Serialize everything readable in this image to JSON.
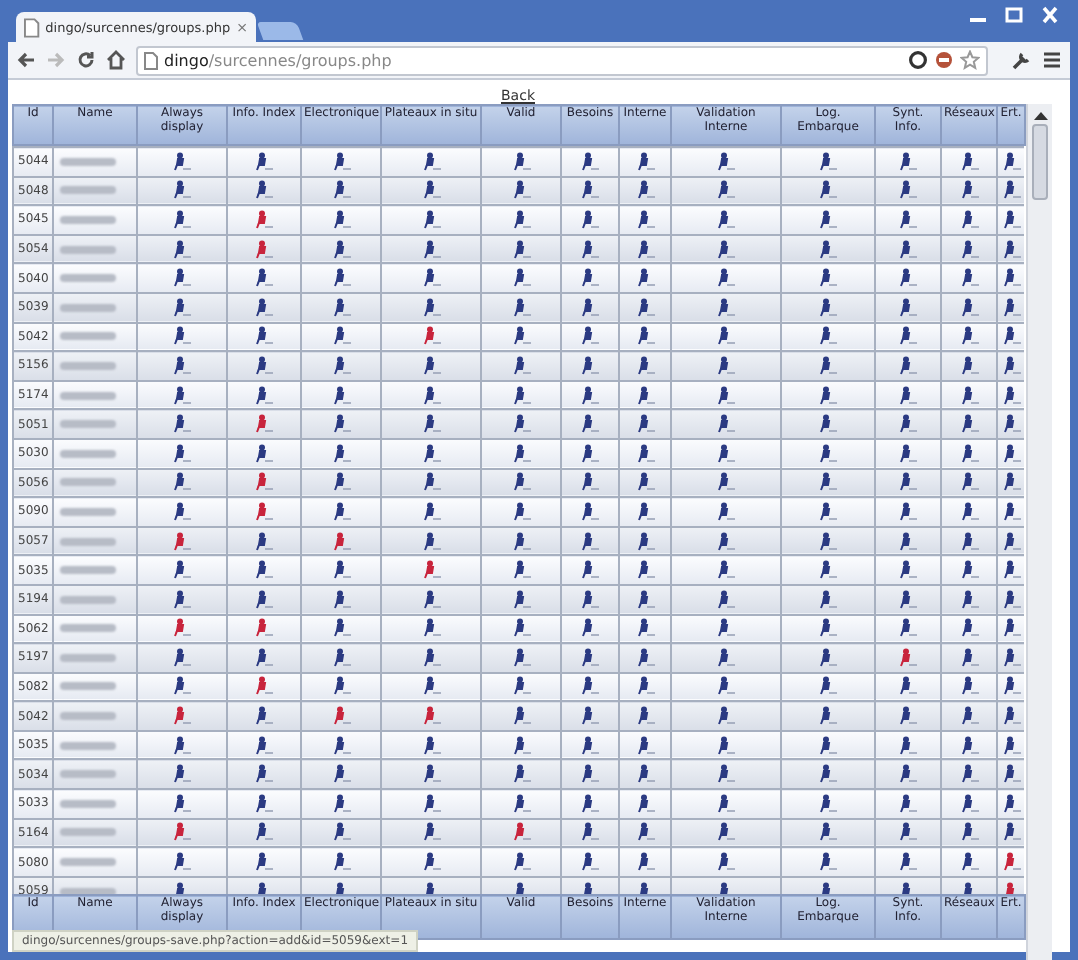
{
  "window": {
    "tab_title": "dingo/surcennes/groups.php",
    "tab_close": "×"
  },
  "address_bar": {
    "host": "dingo",
    "path": "/surcennes/groups.php"
  },
  "back_link": "Back",
  "columns": [
    "Id",
    "Name",
    "Always display",
    "Info. Index",
    "Electronique",
    "Plateaux in situ",
    "Valid",
    "Besoins",
    "Interne",
    "Validation Interne",
    "Log. Embarque",
    "Synt. Info.",
    "Réseaux",
    "Ert."
  ],
  "rows": [
    {
      "id": "5044",
      "alerts": [
        false,
        false,
        false,
        false,
        false,
        false,
        false,
        false,
        false,
        false,
        false,
        false
      ]
    },
    {
      "id": "5048",
      "alerts": [
        false,
        false,
        false,
        false,
        false,
        false,
        false,
        false,
        false,
        false,
        false,
        false
      ]
    },
    {
      "id": "5045",
      "alerts": [
        false,
        true,
        false,
        false,
        false,
        false,
        false,
        false,
        false,
        false,
        false,
        false
      ]
    },
    {
      "id": "5054",
      "alerts": [
        false,
        true,
        false,
        false,
        false,
        false,
        false,
        false,
        false,
        false,
        false,
        false
      ]
    },
    {
      "id": "5040",
      "alerts": [
        false,
        false,
        false,
        false,
        false,
        false,
        false,
        false,
        false,
        false,
        false,
        false
      ]
    },
    {
      "id": "5039",
      "alerts": [
        false,
        false,
        false,
        false,
        false,
        false,
        false,
        false,
        false,
        false,
        false,
        false
      ]
    },
    {
      "id": "5042",
      "alerts": [
        false,
        false,
        false,
        true,
        false,
        false,
        false,
        false,
        false,
        false,
        false,
        false
      ]
    },
    {
      "id": "5156",
      "alerts": [
        false,
        false,
        false,
        false,
        false,
        false,
        false,
        false,
        false,
        false,
        false,
        false
      ]
    },
    {
      "id": "5174",
      "alerts": [
        false,
        false,
        false,
        false,
        false,
        false,
        false,
        false,
        false,
        false,
        false,
        false
      ]
    },
    {
      "id": "5051",
      "alerts": [
        false,
        true,
        false,
        false,
        false,
        false,
        false,
        false,
        false,
        false,
        false,
        false
      ]
    },
    {
      "id": "5030",
      "alerts": [
        false,
        false,
        false,
        false,
        false,
        false,
        false,
        false,
        false,
        false,
        false,
        false
      ]
    },
    {
      "id": "5056",
      "alerts": [
        false,
        true,
        false,
        false,
        false,
        false,
        false,
        false,
        false,
        false,
        false,
        false
      ]
    },
    {
      "id": "5090",
      "alerts": [
        false,
        true,
        false,
        false,
        false,
        false,
        false,
        false,
        false,
        false,
        false,
        false
      ]
    },
    {
      "id": "5057",
      "alerts": [
        true,
        false,
        true,
        false,
        false,
        false,
        false,
        false,
        false,
        false,
        false,
        false
      ]
    },
    {
      "id": "5035",
      "alerts": [
        false,
        false,
        false,
        true,
        false,
        false,
        false,
        false,
        false,
        false,
        false,
        false
      ]
    },
    {
      "id": "5194",
      "alerts": [
        false,
        false,
        false,
        false,
        false,
        false,
        false,
        false,
        false,
        false,
        false,
        false
      ]
    },
    {
      "id": "5062",
      "alerts": [
        true,
        true,
        false,
        false,
        false,
        false,
        false,
        false,
        false,
        false,
        false,
        false
      ]
    },
    {
      "id": "5197",
      "alerts": [
        false,
        false,
        false,
        false,
        false,
        false,
        false,
        false,
        false,
        true,
        false,
        false
      ]
    },
    {
      "id": "5082",
      "alerts": [
        false,
        true,
        false,
        false,
        false,
        false,
        false,
        false,
        false,
        false,
        false,
        false
      ]
    },
    {
      "id": "5042",
      "alerts": [
        true,
        false,
        true,
        true,
        false,
        false,
        false,
        false,
        false,
        false,
        false,
        false
      ]
    },
    {
      "id": "5035",
      "alerts": [
        false,
        false,
        false,
        false,
        false,
        false,
        false,
        false,
        false,
        false,
        false,
        false
      ]
    },
    {
      "id": "5034",
      "alerts": [
        false,
        false,
        false,
        false,
        false,
        false,
        false,
        false,
        false,
        false,
        false,
        false
      ]
    },
    {
      "id": "5033",
      "alerts": [
        false,
        false,
        false,
        false,
        false,
        false,
        false,
        false,
        false,
        false,
        false,
        false
      ]
    },
    {
      "id": "5164",
      "alerts": [
        true,
        false,
        false,
        false,
        true,
        false,
        false,
        false,
        false,
        false,
        false,
        false
      ]
    },
    {
      "id": "5080",
      "alerts": [
        false,
        false,
        false,
        false,
        false,
        false,
        false,
        false,
        false,
        false,
        false,
        true
      ]
    },
    {
      "id": "5059",
      "alerts": [
        false,
        false,
        false,
        false,
        false,
        false,
        false,
        false,
        false,
        false,
        false,
        true
      ]
    }
  ],
  "footer_columns": [
    "Id",
    "Name",
    "Always display",
    "Info. Index",
    "Electronique",
    "Plateaux in situ",
    "Valid",
    "Besoins",
    "Interne",
    "Validation Interne",
    "Log. Embarque",
    "Synt. Info.",
    "Réseaux",
    "Ert."
  ],
  "status_bar": "dingo/surcennes/groups-save.php?action=add&id=5059&ext=1"
}
